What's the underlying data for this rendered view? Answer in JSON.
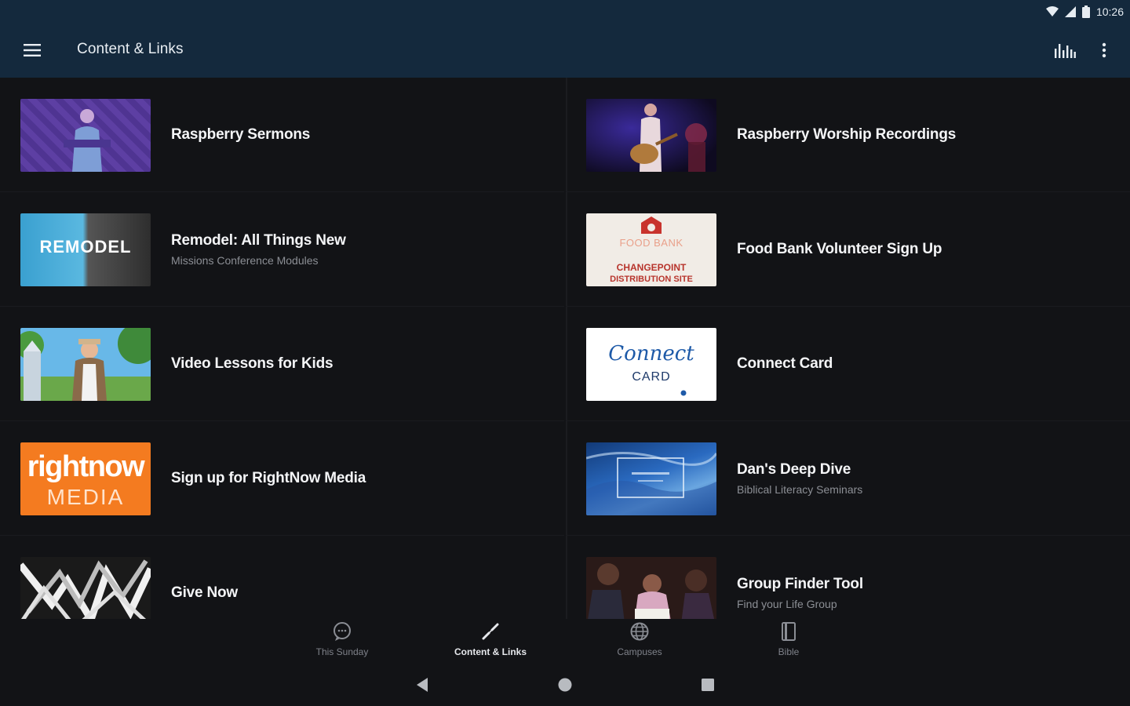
{
  "status": {
    "time": "10:26"
  },
  "app_bar": {
    "title": "Content & Links",
    "menu_icon": "hamburger-menu-icon",
    "actions": [
      "audio-bars-icon",
      "more-vert-icon"
    ]
  },
  "items": [
    {
      "title": "Raspberry Sermons",
      "subtitle": ""
    },
    {
      "title": "Raspberry Worship Recordings",
      "subtitle": ""
    },
    {
      "title": "Remodel: All Things New",
      "subtitle": "Missions Conference Modules"
    },
    {
      "title": "Food Bank Volunteer Sign Up",
      "subtitle": ""
    },
    {
      "title": "Video Lessons for Kids",
      "subtitle": ""
    },
    {
      "title": "Connect Card",
      "subtitle": ""
    },
    {
      "title": "Sign up for RightNow Media",
      "subtitle": ""
    },
    {
      "title": "Dan's Deep Dive",
      "subtitle": "Biblical Literacy Seminars"
    },
    {
      "title": "Give Now",
      "subtitle": ""
    },
    {
      "title": "Group Finder Tool",
      "subtitle": "Find your Life Group"
    }
  ],
  "thumb_text": {
    "remodel": "REMODEL",
    "foodbank_top": "FOOD BANK",
    "foodbank_line1": "CHANGEPOINT",
    "foodbank_line2": "DISTRIBUTION SITE",
    "connect_script": "Connect",
    "connect_card": "CARD",
    "rightnow_1": "rightnow",
    "rightnow_2": "MEDIA"
  },
  "bottom_nav": [
    {
      "label": "This Sunday",
      "icon": "chat-bubble-icon",
      "active": false
    },
    {
      "label": "Content & Links",
      "icon": "link-icon",
      "active": true
    },
    {
      "label": "Campuses",
      "icon": "globe-icon",
      "active": false
    },
    {
      "label": "Bible",
      "icon": "book-icon",
      "active": false
    }
  ],
  "colors": {
    "app_bar": "#14293d",
    "background": "#121316",
    "rightnow_orange": "#f47b20"
  }
}
